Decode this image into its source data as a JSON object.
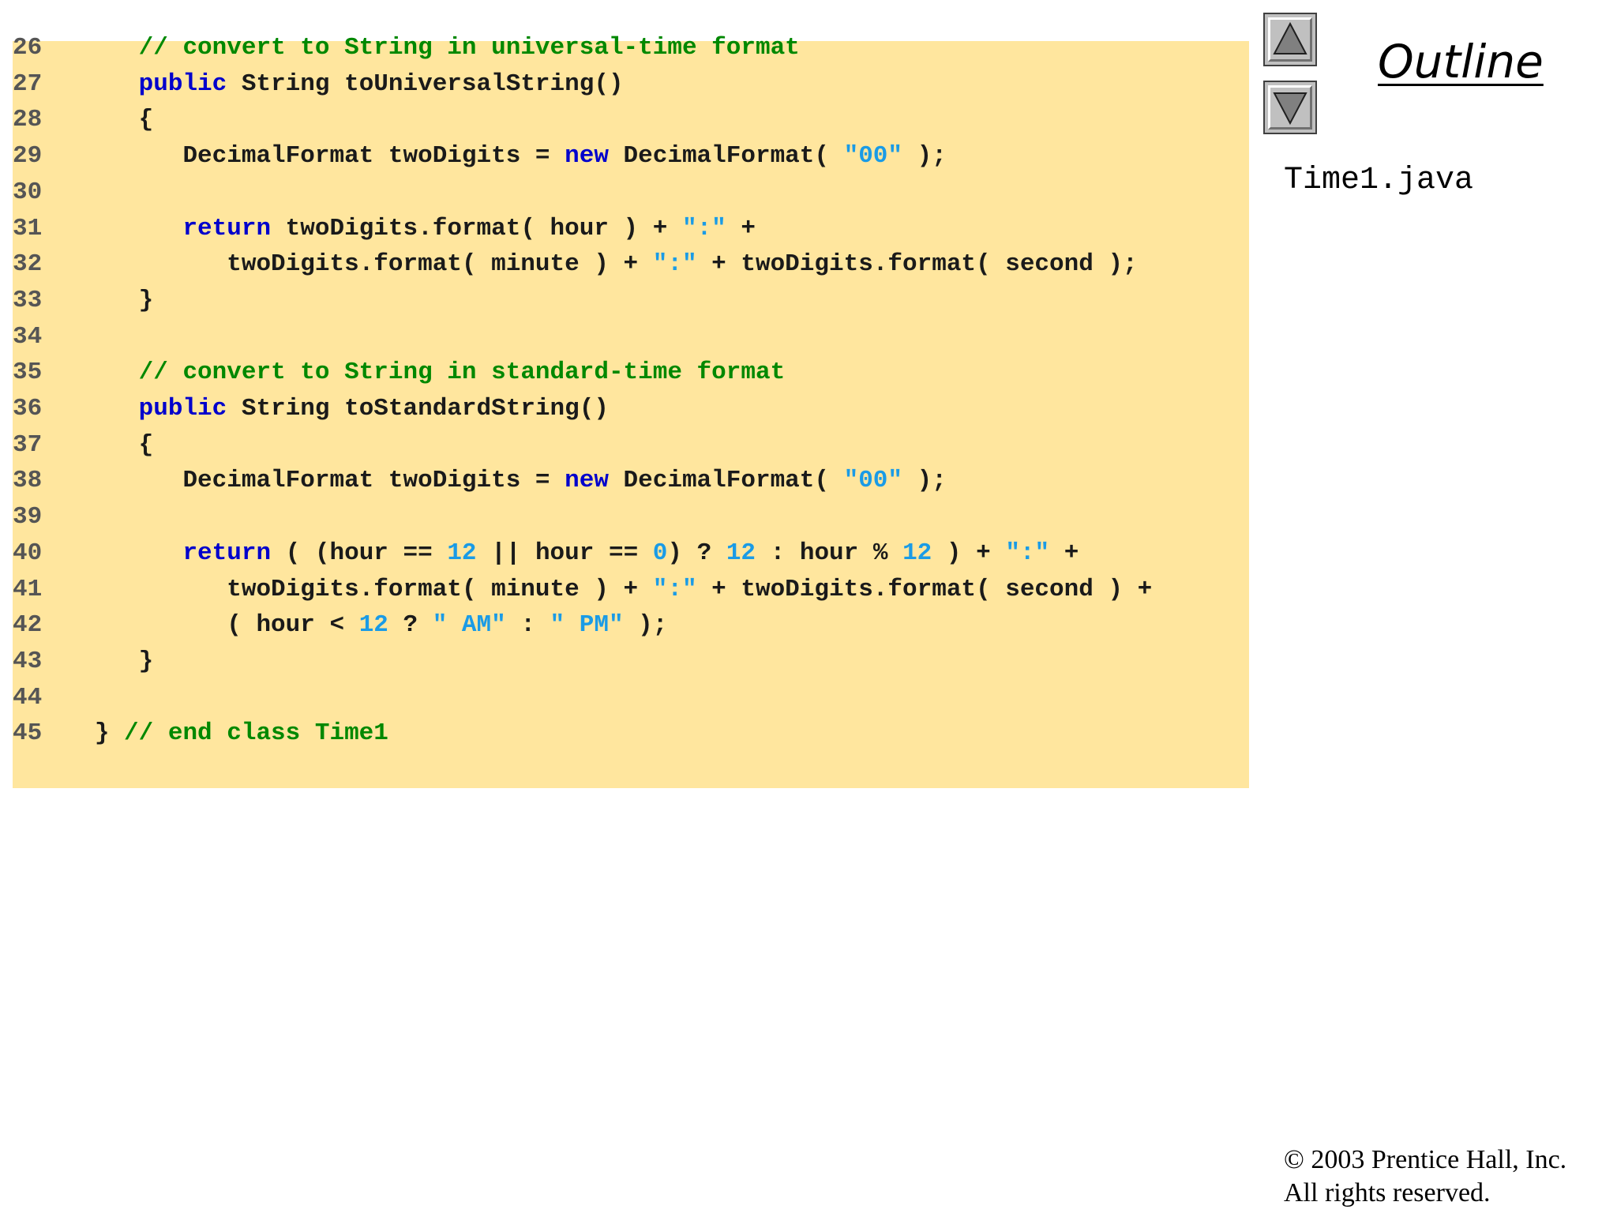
{
  "code": {
    "lines": [
      {
        "num": "26",
        "tokens": [
          {
            "t": "    "
          },
          {
            "c": "cm",
            "t": "// convert to String in universal-time format"
          }
        ]
      },
      {
        "num": "27",
        "tokens": [
          {
            "t": "    "
          },
          {
            "c": "kw",
            "t": "public"
          },
          {
            "t": " String toUniversalString()"
          }
        ]
      },
      {
        "num": "28",
        "tokens": [
          {
            "t": "    {"
          }
        ]
      },
      {
        "num": "29",
        "tokens": [
          {
            "t": "       DecimalFormat twoDigits = "
          },
          {
            "c": "kw",
            "t": "new"
          },
          {
            "t": " DecimalFormat( "
          },
          {
            "c": "st",
            "t": "\"00\""
          },
          {
            "t": " );"
          }
        ]
      },
      {
        "num": "30",
        "tokens": []
      },
      {
        "num": "31",
        "tokens": [
          {
            "t": "       "
          },
          {
            "c": "kw",
            "t": "return"
          },
          {
            "t": " twoDigits.format( hour ) + "
          },
          {
            "c": "st",
            "t": "\":\""
          },
          {
            "t": " +"
          }
        ]
      },
      {
        "num": "32",
        "tokens": [
          {
            "t": "          twoDigits.format( minute ) + "
          },
          {
            "c": "st",
            "t": "\":\""
          },
          {
            "t": " + twoDigits.format( second );"
          }
        ]
      },
      {
        "num": "33",
        "tokens": [
          {
            "t": "    }"
          }
        ]
      },
      {
        "num": "34",
        "tokens": []
      },
      {
        "num": "35",
        "tokens": [
          {
            "t": "    "
          },
          {
            "c": "cm",
            "t": "// convert to String in standard-time format"
          }
        ]
      },
      {
        "num": "36",
        "tokens": [
          {
            "t": "    "
          },
          {
            "c": "kw",
            "t": "public"
          },
          {
            "t": " String toStandardString()"
          }
        ]
      },
      {
        "num": "37",
        "tokens": [
          {
            "t": "    {"
          }
        ]
      },
      {
        "num": "38",
        "tokens": [
          {
            "t": "       DecimalFormat twoDigits = "
          },
          {
            "c": "kw",
            "t": "new"
          },
          {
            "t": " DecimalFormat( "
          },
          {
            "c": "st",
            "t": "\"00\""
          },
          {
            "t": " );"
          }
        ]
      },
      {
        "num": "39",
        "tokens": []
      },
      {
        "num": "40",
        "tokens": [
          {
            "t": "       "
          },
          {
            "c": "kw",
            "t": "return"
          },
          {
            "t": " ( (hour == "
          },
          {
            "c": "nm",
            "t": "12"
          },
          {
            "t": " || hour == "
          },
          {
            "c": "nm",
            "t": "0"
          },
          {
            "t": ") ? "
          },
          {
            "c": "nm",
            "t": "12"
          },
          {
            "t": " : hour % "
          },
          {
            "c": "nm",
            "t": "12"
          },
          {
            "t": " ) + "
          },
          {
            "c": "st",
            "t": "\":\""
          },
          {
            "t": " +"
          }
        ]
      },
      {
        "num": "41",
        "tokens": [
          {
            "t": "          twoDigits.format( minute ) + "
          },
          {
            "c": "st",
            "t": "\":\""
          },
          {
            "t": " + twoDigits.format( second ) +"
          }
        ]
      },
      {
        "num": "42",
        "tokens": [
          {
            "t": "          ( hour < "
          },
          {
            "c": "nm",
            "t": "12"
          },
          {
            "t": " ? "
          },
          {
            "c": "st",
            "t": "\" AM\""
          },
          {
            "t": " : "
          },
          {
            "c": "st",
            "t": "\" PM\""
          },
          {
            "t": " );"
          }
        ]
      },
      {
        "num": "43",
        "tokens": [
          {
            "t": "    }"
          }
        ]
      },
      {
        "num": "44",
        "tokens": []
      },
      {
        "num": "45",
        "tokens": [
          {
            "t": " } "
          },
          {
            "c": "cm",
            "t": "// end class Time1"
          }
        ]
      }
    ]
  },
  "sidebar": {
    "outline_title": "Outline",
    "file_name": "Time1.java",
    "up_icon": "triangle-up-icon",
    "down_icon": "triangle-down-icon"
  },
  "footer": {
    "copyright_line1": "© 2003 Prentice Hall, Inc.",
    "copyright_line2": "All rights reserved."
  },
  "colors": {
    "panel_background": "#ffe69e",
    "keyword": "#0000cc",
    "comment": "#008800",
    "literal": "#1a9be6",
    "line_number": "#555555"
  }
}
